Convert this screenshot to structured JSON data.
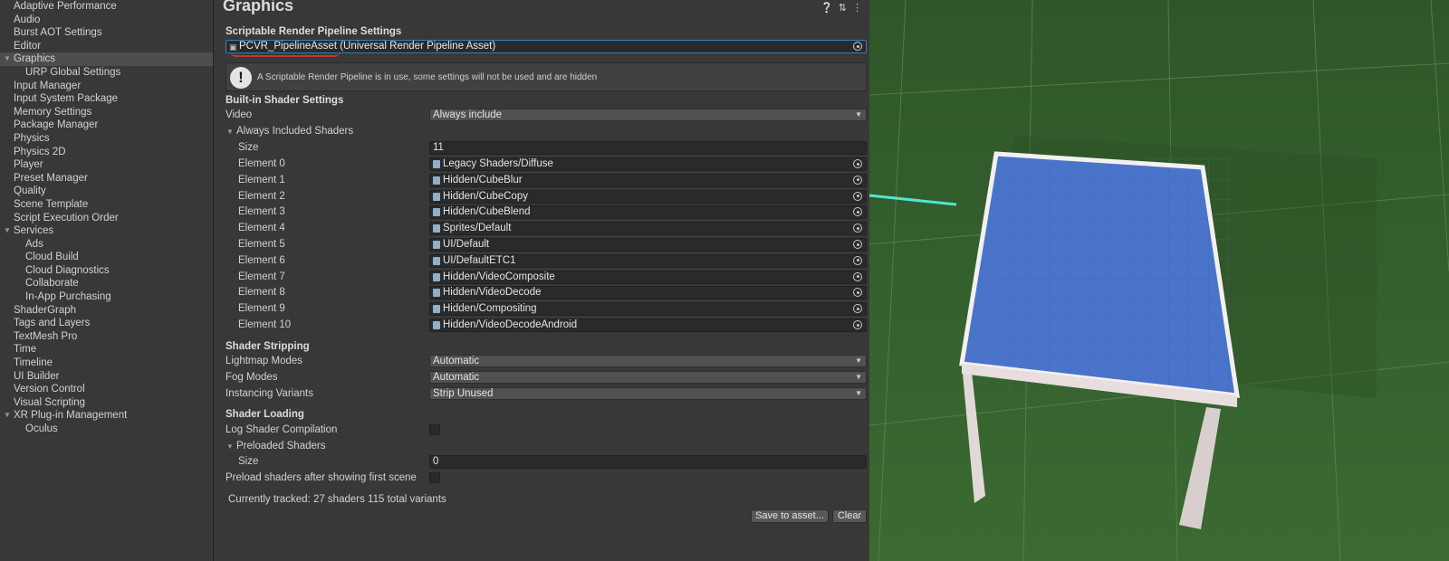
{
  "sidebar": {
    "items": [
      {
        "label": "Adaptive Performance",
        "level": 0
      },
      {
        "label": "Audio",
        "level": 0
      },
      {
        "label": "Burst AOT Settings",
        "level": 0
      },
      {
        "label": "Editor",
        "level": 0
      },
      {
        "label": "Graphics",
        "level": 0,
        "selected": true,
        "expanded": true
      },
      {
        "label": "URP Global Settings",
        "level": 1
      },
      {
        "label": "Input Manager",
        "level": 0
      },
      {
        "label": "Input System Package",
        "level": 0
      },
      {
        "label": "Memory Settings",
        "level": 0
      },
      {
        "label": "Package Manager",
        "level": 0
      },
      {
        "label": "Physics",
        "level": 0
      },
      {
        "label": "Physics 2D",
        "level": 0
      },
      {
        "label": "Player",
        "level": 0
      },
      {
        "label": "Preset Manager",
        "level": 0
      },
      {
        "label": "Quality",
        "level": 0
      },
      {
        "label": "Scene Template",
        "level": 0
      },
      {
        "label": "Script Execution Order",
        "level": 0
      },
      {
        "label": "Services",
        "level": 0,
        "expanded": true
      },
      {
        "label": "Ads",
        "level": 1
      },
      {
        "label": "Cloud Build",
        "level": 1
      },
      {
        "label": "Cloud Diagnostics",
        "level": 1
      },
      {
        "label": "Collaborate",
        "level": 1
      },
      {
        "label": "In-App Purchasing",
        "level": 1
      },
      {
        "label": "ShaderGraph",
        "level": 0
      },
      {
        "label": "Tags and Layers",
        "level": 0
      },
      {
        "label": "TextMesh Pro",
        "level": 0
      },
      {
        "label": "Time",
        "level": 0
      },
      {
        "label": "Timeline",
        "level": 0
      },
      {
        "label": "UI Builder",
        "level": 0
      },
      {
        "label": "Version Control",
        "level": 0
      },
      {
        "label": "Visual Scripting",
        "level": 0
      },
      {
        "label": "XR Plug-in Management",
        "level": 0,
        "expanded": true
      },
      {
        "label": "Oculus",
        "level": 1
      }
    ]
  },
  "inspector": {
    "title": "Graphics",
    "srp_section": "Scriptable Render Pipeline Settings",
    "pipeline_asset": "PCVR_PipelineAsset (Universal Render Pipeline Asset)",
    "help_message": "A Scriptable Render Pipeline is in use, some settings will not be used and are hidden",
    "builtin_section": "Built-in Shader Settings",
    "video_label": "Video",
    "video_value": "Always include",
    "always_included_label": "Always Included Shaders",
    "size_label": "Size",
    "size_value": "11",
    "elements": [
      {
        "label": "Element 0",
        "value": "Legacy Shaders/Diffuse"
      },
      {
        "label": "Element 1",
        "value": "Hidden/CubeBlur"
      },
      {
        "label": "Element 2",
        "value": "Hidden/CubeCopy"
      },
      {
        "label": "Element 3",
        "value": "Hidden/CubeBlend"
      },
      {
        "label": "Element 4",
        "value": "Sprites/Default"
      },
      {
        "label": "Element 5",
        "value": "UI/Default"
      },
      {
        "label": "Element 6",
        "value": "UI/DefaultETC1"
      },
      {
        "label": "Element 7",
        "value": "Hidden/VideoComposite"
      },
      {
        "label": "Element 8",
        "value": "Hidden/VideoDecode"
      },
      {
        "label": "Element 9",
        "value": "Hidden/Compositing"
      },
      {
        "label": "Element 10",
        "value": "Hidden/VideoDecodeAndroid"
      }
    ],
    "stripping_section": "Shader Stripping",
    "lightmap_label": "Lightmap Modes",
    "lightmap_value": "Automatic",
    "fog_label": "Fog Modes",
    "fog_value": "Automatic",
    "instancing_label": "Instancing Variants",
    "instancing_value": "Strip Unused",
    "loading_section": "Shader Loading",
    "log_compilation_label": "Log Shader Compilation",
    "log_compilation_checked": false,
    "preloaded_label": "Preloaded Shaders",
    "preloaded_size_label": "Size",
    "preloaded_size_value": "0",
    "preload_after_label": "Preload shaders after showing first scene",
    "preload_after_checked": false,
    "tracked_text": "Currently tracked: 27 shaders 115 total variants",
    "save_button": "Save to asset...",
    "clear_button": "Clear"
  },
  "colors": {
    "panel_bg": "#383838",
    "field_bg": "#2a2a2a",
    "selected_row": "#4d4d4d",
    "focus_border": "#3a79bb",
    "annotation_red": "#c0392b",
    "scene_ground": "#345d2c",
    "table_top": "#4a74c9",
    "table_frame": "#e8dede"
  }
}
